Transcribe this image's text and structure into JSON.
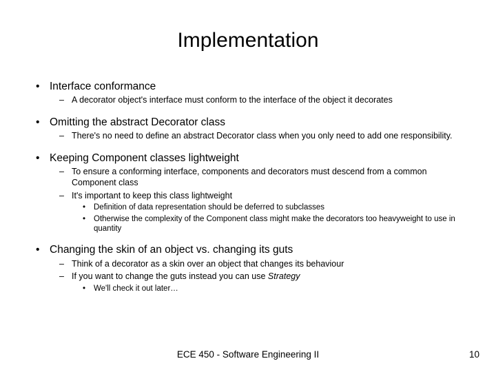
{
  "title": "Implementation",
  "b1": {
    "heading": "Interface conformance",
    "sub1": "A decorator object's interface must conform to the interface of the object it decorates"
  },
  "b2": {
    "heading": "Omitting the abstract Decorator class",
    "sub1": "There's no need to define an abstract Decorator class when you only need to add one responsibility."
  },
  "b3": {
    "heading": "Keeping Component classes lightweight",
    "sub1": "To ensure a conforming interface, components and decorators must descend from a common Component class",
    "sub2": "It's important to keep this class lightweight",
    "subsub1": "Definition of data representation should be deferred to subclasses",
    "subsub2": "Otherwise the complexity of the Component class might make the decorators too heavyweight to use in quantity"
  },
  "b4": {
    "heading": "Changing the skin of an object vs. changing its guts",
    "sub1": "Think of a decorator as a skin over an object that changes its behaviour",
    "sub2_pre": "If you want to change the guts instead you can use ",
    "sub2_em": "Strategy",
    "subsub1": "We'll check it out later…"
  },
  "footer": "ECE 450 - Software Engineering II",
  "pagenum": "10"
}
